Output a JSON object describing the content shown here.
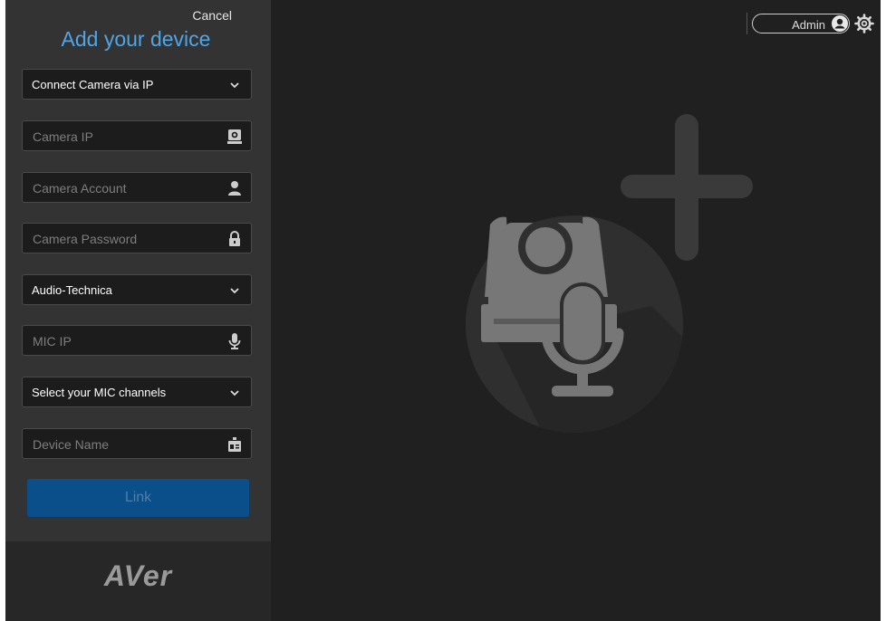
{
  "header": {
    "cancel_label": "Cancel",
    "title": "Add your device"
  },
  "form": {
    "connection_mode": "Connect Camera via IP",
    "camera_ip_placeholder": "Camera IP",
    "camera_account_placeholder": "Camera Account",
    "camera_password_placeholder": "Camera Password",
    "mic_brand": "Audio-Technica",
    "mic_ip_placeholder": "MIC IP",
    "mic_channels": "Select your MIC channels",
    "device_name_placeholder": "Device Name",
    "link_label": "Link"
  },
  "footer": {
    "logo_text": "AVer"
  },
  "topbar": {
    "user_label": "Admin"
  },
  "icons": {
    "chevron": "chevron-down-icon",
    "camera": "camera-icon",
    "user": "user-icon",
    "lock": "lock-icon",
    "mic": "microphone-icon",
    "device": "device-icon",
    "gear": "gear-icon",
    "avatar": "user-avatar-icon"
  },
  "colors": {
    "accent": "#4ea6e8",
    "button": "#0a4e8a",
    "sidebar": "#333333",
    "main": "#202020"
  }
}
